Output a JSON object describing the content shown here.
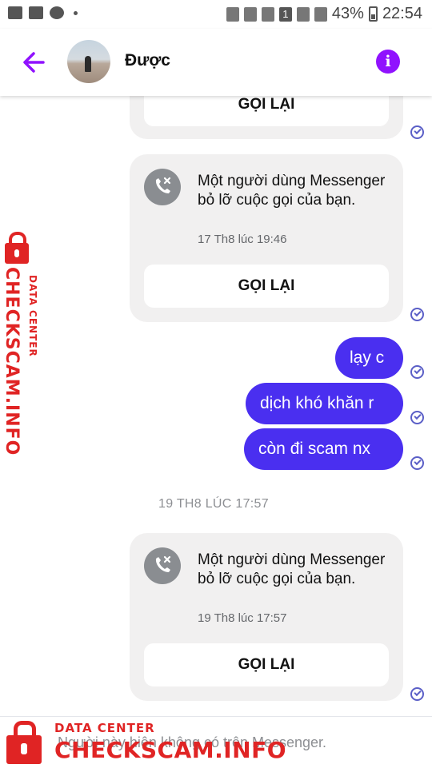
{
  "status_bar": {
    "battery": "43%",
    "time": "22:54",
    "sim_badge": "1"
  },
  "header": {
    "contact_name": "Được",
    "info_label": "i"
  },
  "messages": {
    "call_card_partial": {
      "button": "GỌI LẠI"
    },
    "call_card_1": {
      "text": "Một người dùng Messenger bỏ lỡ cuộc gọi của bạn.",
      "time": "17 Th8 lúc 19:46",
      "button": "GỌI LẠI"
    },
    "sent": [
      "lạy c",
      "dịch khó khăn r",
      "còn đi scam nx"
    ],
    "date_separator": "19 TH8 LÚC 17:57",
    "call_card_2": {
      "text": "Một người dùng Messenger bỏ lỡ cuộc gọi của bạn.",
      "time": "19 Th8 lúc 17:57",
      "button": "GỌI LẠI"
    }
  },
  "footer": {
    "notice": "Người này hiện không có trên Messenger."
  },
  "watermark": {
    "small": "DATA CENTER",
    "big": "CHECKSCAM.INFO"
  },
  "colors": {
    "accent": "#9012fe",
    "sent_bubble": "#4a2ff0",
    "watermark": "#e02424"
  },
  "icons": [
    "back-arrow-icon",
    "info-icon",
    "missed-call-icon",
    "seen-check-icon",
    "lock-icon"
  ]
}
